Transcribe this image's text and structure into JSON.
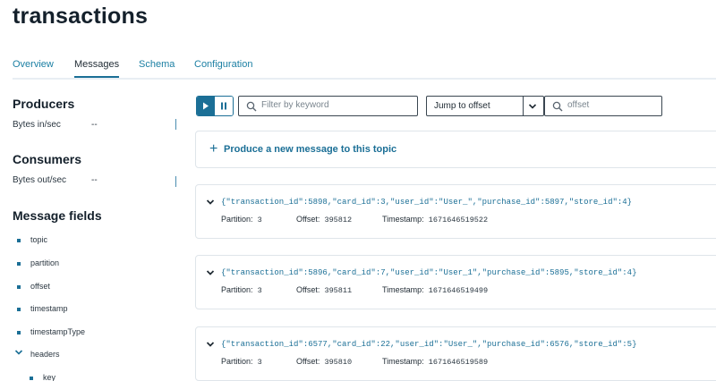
{
  "page": {
    "title": "transactions"
  },
  "tabs": [
    {
      "label": "Overview",
      "active": false
    },
    {
      "label": "Messages",
      "active": true
    },
    {
      "label": "Schema",
      "active": false
    },
    {
      "label": "Configuration",
      "active": false
    }
  ],
  "sidebar": {
    "producers": {
      "heading": "Producers",
      "stat_label": "Bytes in/sec",
      "stat_value": "--"
    },
    "consumers": {
      "heading": "Consumers",
      "stat_label": "Bytes out/sec",
      "stat_value": "--"
    },
    "fields": {
      "heading": "Message fields",
      "items": [
        "topic",
        "partition",
        "offset",
        "timestamp",
        "timestampType",
        "headers"
      ],
      "expanded_item": "headers",
      "sub_items": [
        "key"
      ]
    }
  },
  "toolbar": {
    "filter_placeholder": "Filter by keyword",
    "jump_select_value": "Jump to offset",
    "offset_placeholder": "offset"
  },
  "produce": {
    "label": "Produce a new message to this topic"
  },
  "meta_labels": {
    "partition": "Partition:",
    "offset": "Offset:",
    "timestamp": "Timestamp:"
  },
  "messages": [
    {
      "value": "{\"transaction_id\":5898,\"card_id\":3,\"user_id\":\"User_\",\"purchase_id\":5897,\"store_id\":4}",
      "partition": "3",
      "offset": "395812",
      "timestamp": "1671646519522"
    },
    {
      "value": "{\"transaction_id\":5896,\"card_id\":7,\"user_id\":\"User_1\",\"purchase_id\":5895,\"store_id\":4}",
      "partition": "3",
      "offset": "395811",
      "timestamp": "1671646519499"
    },
    {
      "value": "{\"transaction_id\":6577,\"card_id\":22,\"user_id\":\"User_\",\"purchase_id\":6576,\"store_id\":5}",
      "partition": "3",
      "offset": "395810",
      "timestamp": "1671646519589"
    }
  ],
  "colors": {
    "accent": "#1b6f96",
    "link": "#1b7fa3",
    "border": "#dfe5ea"
  }
}
